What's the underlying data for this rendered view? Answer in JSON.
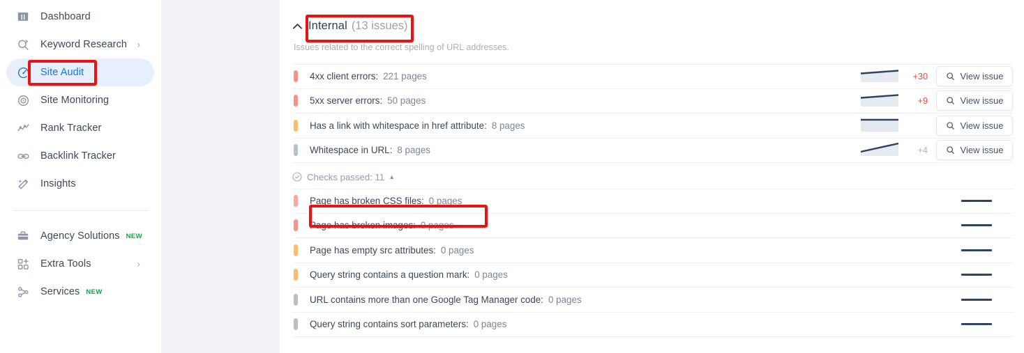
{
  "sidebar": {
    "items": [
      {
        "label": "Dashboard",
        "icon": "dashboard-icon",
        "active": false,
        "chevron": false,
        "badge": ""
      },
      {
        "label": "Keyword Research",
        "icon": "keyword-research-icon",
        "active": false,
        "chevron": true,
        "badge": ""
      },
      {
        "label": "Site Audit",
        "icon": "site-audit-icon",
        "active": true,
        "chevron": false,
        "badge": ""
      },
      {
        "label": "Site Monitoring",
        "icon": "site-monitoring-icon",
        "active": false,
        "chevron": false,
        "badge": ""
      },
      {
        "label": "Rank Tracker",
        "icon": "rank-tracker-icon",
        "active": false,
        "chevron": false,
        "badge": ""
      },
      {
        "label": "Backlink Tracker",
        "icon": "backlink-tracker-icon",
        "active": false,
        "chevron": false,
        "badge": ""
      },
      {
        "label": "Insights",
        "icon": "insights-icon",
        "active": false,
        "chevron": false,
        "badge": ""
      }
    ],
    "items_lower": [
      {
        "label": "Agency Solutions",
        "icon": "briefcase-icon",
        "chevron": false,
        "badge": "NEW"
      },
      {
        "label": "Extra Tools",
        "icon": "grid-plus-icon",
        "chevron": true,
        "badge": ""
      },
      {
        "label": "Services",
        "icon": "services-icon",
        "chevron": false,
        "badge": "NEW"
      }
    ],
    "chevron_glyph": "›",
    "accent_active": "#1a73e8",
    "badge_color": "#16a34a"
  },
  "section": {
    "title": "Internal",
    "count": "(13 issues)",
    "subtitle": "Issues related to the correct spelling of URL addresses.",
    "collapse_icon": "caret-up-icon"
  },
  "issues": [
    {
      "label": "4xx client errors:",
      "value": "221 pages",
      "severity": "error",
      "severity_color": "#f79286",
      "delta": "+30",
      "delta_kind": "up",
      "trend": "slight-up",
      "button": "View issue"
    },
    {
      "label": "5xx server errors:",
      "value": "50 pages",
      "severity": "error",
      "severity_color": "#f79286",
      "delta": "+9",
      "delta_kind": "up",
      "trend": "slight-up",
      "button": "View issue"
    },
    {
      "label": "Has a link with whitespace in href attribute:",
      "value": "8 pages",
      "severity": "warning",
      "severity_color": "#fbbd6d",
      "delta": "",
      "delta_kind": "none",
      "trend": "flat",
      "button": "View issue"
    },
    {
      "label": "Whitespace in URL:",
      "value": "8 pages",
      "severity": "notice",
      "severity_color": "#b7bfcb",
      "delta": "+4",
      "delta_kind": "flat",
      "trend": "up",
      "button": "View issue"
    }
  ],
  "checks_passed": {
    "label": "Checks passed: 11",
    "icon": "check-circle-icon",
    "caret": "▲"
  },
  "passed_checks": [
    {
      "label": "Page has broken CSS files:",
      "value": "0 pages",
      "severity": "error",
      "severity_color": "#f7a79d"
    },
    {
      "label": "Page has broken images:",
      "value": "0 pages",
      "severity": "error",
      "severity_color": "#f79286"
    },
    {
      "label": "Page has empty src attributes:",
      "value": "0 pages",
      "severity": "warning",
      "severity_color": "#fbbd6d"
    },
    {
      "label": "Query string contains a question mark:",
      "value": "0 pages",
      "severity": "warning",
      "severity_color": "#fbbd6d"
    },
    {
      "label": "URL contains more than one Google Tag Manager code:",
      "value": "0 pages",
      "severity": "notice",
      "severity_color": "#b7bfcb"
    },
    {
      "label": "Query string contains sort parameters:",
      "value": "0 pages",
      "severity": "notice",
      "severity_color": "#b7bfcb"
    }
  ],
  "annotations": [
    {
      "name": "highlight-site-audit"
    },
    {
      "name": "highlight-internal-heading"
    },
    {
      "name": "highlight-broken-css-row"
    }
  ],
  "icons": {
    "magnifier": "search-icon"
  }
}
